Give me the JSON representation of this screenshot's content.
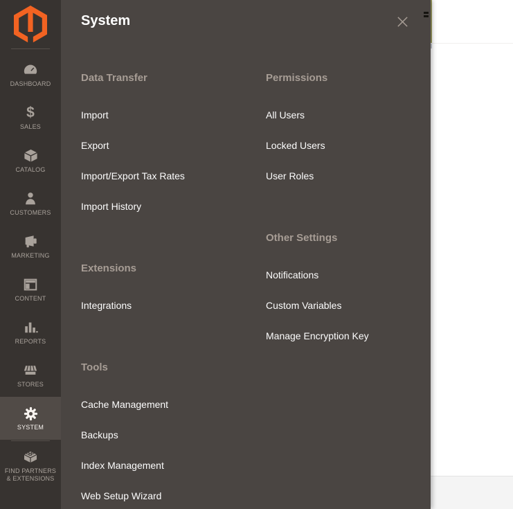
{
  "colors": {
    "brand_orange": "#f26322",
    "sidebar_bg": "#373330",
    "flyout_bg": "#4a4542",
    "active_item_bg": "#514b47",
    "section_title_text": "#a79d95",
    "menu_link_text": "#fcfcfc",
    "sidebar_label_text": "#a9a29b",
    "page_footer_bg": "#f4f4f4",
    "accent_line": "#9b9b60"
  },
  "sidebar": {
    "logo_icon": "magento-logo",
    "items": [
      {
        "icon": "dashboard-icon",
        "label": "DASHBOARD",
        "active": false
      },
      {
        "icon": "sales-icon",
        "label": "SALES",
        "active": false
      },
      {
        "icon": "catalog-icon",
        "label": "CATALOG",
        "active": false
      },
      {
        "icon": "customers-icon",
        "label": "CUSTOMERS",
        "active": false
      },
      {
        "icon": "marketing-icon",
        "label": "MARKETING",
        "active": false
      },
      {
        "icon": "content-icon",
        "label": "CONTENT",
        "active": false
      },
      {
        "icon": "reports-icon",
        "label": "REPORTS",
        "active": false
      },
      {
        "icon": "stores-icon",
        "label": "STORES",
        "active": false
      },
      {
        "icon": "system-icon",
        "label": "SYSTEM",
        "active": true
      },
      {
        "icon": "find-partners-icon",
        "label": "FIND PARTNERS & EXTENSIONS",
        "active": false
      }
    ]
  },
  "flyout": {
    "title": "System",
    "close_icon": "close-icon",
    "columns": [
      {
        "sections": [
          {
            "title": "Data Transfer",
            "items": [
              "Import",
              "Export",
              "Import/Export Tax Rates",
              "Import History"
            ]
          },
          {
            "title": "Extensions",
            "items": [
              "Integrations"
            ]
          },
          {
            "title": "Tools",
            "items": [
              "Cache Management",
              "Backups",
              "Index Management",
              "Web Setup Wizard"
            ]
          }
        ]
      },
      {
        "sections": [
          {
            "title": "Permissions",
            "items": [
              "All Users",
              "Locked Users",
              "User Roles"
            ]
          },
          {
            "title": "Other Settings",
            "items": [
              "Notifications",
              "Custom Variables",
              "Manage Encryption Key"
            ]
          }
        ]
      }
    ]
  }
}
